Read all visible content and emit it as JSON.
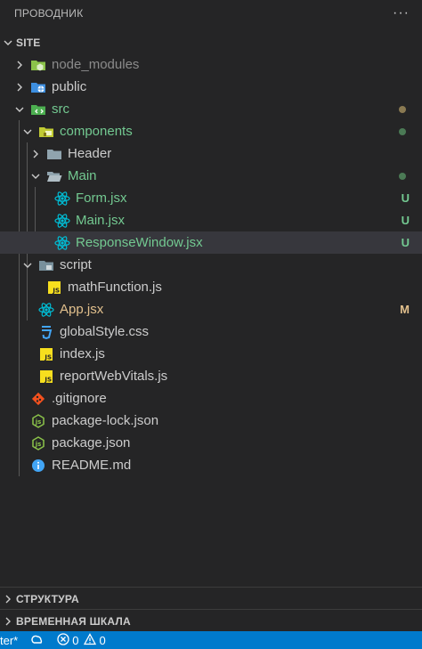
{
  "header": {
    "title": "ПРОВОДНИК",
    "more": "···"
  },
  "root": {
    "label": "SITE"
  },
  "tree": [
    {
      "label": "node_modules",
      "color": "dim",
      "icon": "node-folder-icon",
      "chev": "right",
      "badge": "",
      "dot": ""
    },
    {
      "label": "public",
      "color": "normal",
      "icon": "public-folder-icon",
      "chev": "right",
      "badge": "",
      "dot": ""
    },
    {
      "label": "src",
      "color": "green",
      "icon": "src-folder-icon",
      "chev": "down",
      "badge": "",
      "dot": "#8a7a52"
    },
    {
      "label": "components",
      "color": "green",
      "icon": "components-folder-icon",
      "chev": "down",
      "badge": "",
      "dot": "#4b7a55"
    },
    {
      "label": "Header",
      "color": "normal",
      "icon": "folder-icon",
      "chev": "right",
      "badge": "",
      "dot": ""
    },
    {
      "label": "Main",
      "color": "green",
      "icon": "folder-open-icon",
      "chev": "down",
      "badge": "",
      "dot": "#4b7a55"
    },
    {
      "label": "Form.jsx",
      "color": "green",
      "icon": "react-icon",
      "chev": "",
      "badge": "U",
      "dot": ""
    },
    {
      "label": "Main.jsx",
      "color": "green",
      "icon": "react-icon",
      "chev": "",
      "badge": "U",
      "dot": ""
    },
    {
      "label": "ResponseWindow.jsx",
      "color": "green",
      "icon": "react-icon",
      "chev": "",
      "badge": "U",
      "dot": ""
    },
    {
      "label": "script",
      "color": "normal",
      "icon": "script-folder-icon",
      "chev": "down",
      "badge": "",
      "dot": ""
    },
    {
      "label": "mathFunction.js",
      "color": "normal",
      "icon": "js-icon",
      "chev": "",
      "badge": "",
      "dot": ""
    },
    {
      "label": "App.jsx",
      "color": "yellow",
      "icon": "react-icon",
      "chev": "",
      "badge": "M",
      "dot": ""
    },
    {
      "label": "globalStyle.css",
      "color": "normal",
      "icon": "css-icon",
      "chev": "",
      "badge": "",
      "dot": ""
    },
    {
      "label": "index.js",
      "color": "normal",
      "icon": "js-icon",
      "chev": "",
      "badge": "",
      "dot": ""
    },
    {
      "label": "reportWebVitals.js",
      "color": "normal",
      "icon": "js-icon",
      "chev": "",
      "badge": "",
      "dot": ""
    },
    {
      "label": ".gitignore",
      "color": "normal",
      "icon": "git-icon",
      "chev": "",
      "badge": "",
      "dot": ""
    },
    {
      "label": "package-lock.json",
      "color": "normal",
      "icon": "nodejs-icon",
      "chev": "",
      "badge": "",
      "dot": ""
    },
    {
      "label": "package.json",
      "color": "normal",
      "icon": "nodejs-icon",
      "chev": "",
      "badge": "",
      "dot": ""
    },
    {
      "label": "README.md",
      "color": "normal",
      "icon": "info-icon",
      "chev": "",
      "badge": "",
      "dot": ""
    }
  ],
  "sections": {
    "outline": "СТРУКТУРА",
    "timeline": "ВРЕМЕННАЯ ШКАЛА"
  },
  "status": {
    "branch": "ter*",
    "errors": "0",
    "warnings": "0"
  },
  "colors": {
    "green": "#73c991",
    "yellow": "#e2c08d",
    "accent": "#007acc"
  }
}
